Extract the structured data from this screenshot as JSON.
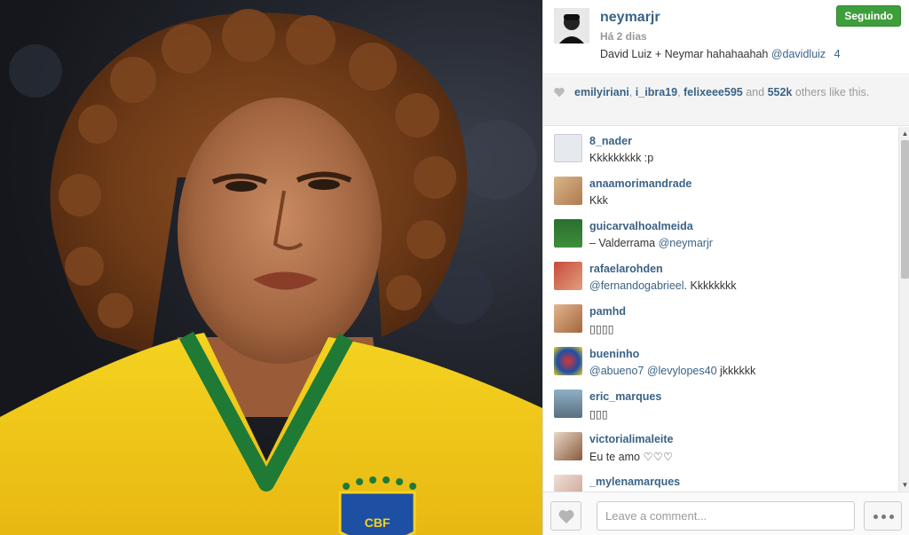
{
  "post": {
    "username": "neymarjr",
    "time_ago": "Há 2 dias",
    "caption_text": "David Luiz + Neymar hahahaahah",
    "caption_mention": "@davidluiz",
    "caption_count": "4",
    "follow_label": "Seguindo"
  },
  "likes": {
    "user1": "emilyiriani",
    "user2": "i_ibra19",
    "user3": "felixeee595",
    "and": "and",
    "count": "552k",
    "rest": "others like this."
  },
  "comments": [
    {
      "user": "8_nader",
      "text": "Kkkkkkkkk :p",
      "mention": ""
    },
    {
      "user": "anaamorimandrade",
      "text": "Kkk",
      "mention": ""
    },
    {
      "user": "guicarvalhoalmeida",
      "text": "– Valderrama ",
      "mention": "@neymarjr"
    },
    {
      "user": "rafaelarohden",
      "text": ". Kkkkkkkk",
      "mention": "@fernandogabrieel"
    },
    {
      "user": "pamhd",
      "text": "▯▯▯▯",
      "mention": ""
    },
    {
      "user": "bueninho",
      "text": " jkkkkkk",
      "mention": "@abueno7 @levylopes40"
    },
    {
      "user": "eric_marques",
      "text": "▯▯▯",
      "mention": ""
    },
    {
      "user": "victorialimaleite",
      "text": "Eu te amo ♡♡♡",
      "mention": ""
    },
    {
      "user": "_mylenamarques",
      "text": "",
      "mention": ""
    }
  ],
  "footer": {
    "comment_placeholder": "Leave a comment..."
  },
  "colors": {
    "link": "#3a6386",
    "follow_green": "#3f9e3c"
  },
  "icons": [
    "heart-icon",
    "more-icon",
    "scroll-up-icon",
    "scroll-down-icon"
  ]
}
